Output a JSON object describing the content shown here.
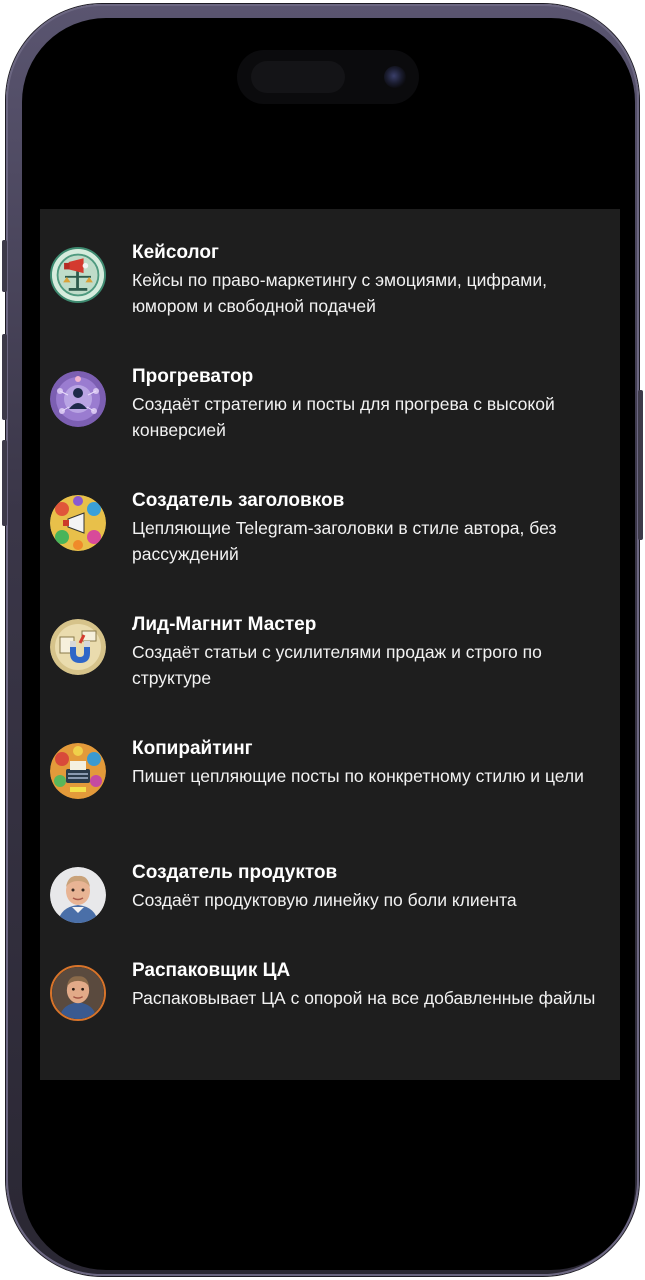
{
  "items": [
    {
      "title": "Кейсолог",
      "description": "Кейсы по право-маркетингу с эмоциями, цифрами, юмором и свободной подачей",
      "avatar_icon": "megaphone-scales-icon"
    },
    {
      "title": "Прогреватор",
      "description": "Создаёт стратегию и посты для прогрева с высокой конверсией",
      "avatar_icon": "person-network-icon"
    },
    {
      "title": "Создатель заголовков",
      "description": "Цепляющие Telegram-заголовки в стиле автора, без рассуждений",
      "avatar_icon": "megaphone-collage-icon"
    },
    {
      "title": "Лид-Магнит Мастер",
      "description": "Создаёт статьи с усилителями продаж и строго по структуре",
      "avatar_icon": "magnet-icon"
    },
    {
      "title": "Копирайтинг",
      "description": "Пишет цепляющие посты по конкретному стилю и цели",
      "avatar_icon": "typewriter-collage-icon"
    },
    {
      "title": "Создатель продуктов",
      "description": "Создаёт продуктовую линейку по боли клиента",
      "avatar_icon": "person-photo-icon"
    },
    {
      "title": "Распаковщик ЦА",
      "description": "Распаковывает ЦА с опорой на все добавленные файлы",
      "avatar_icon": "person-photo-icon"
    }
  ]
}
